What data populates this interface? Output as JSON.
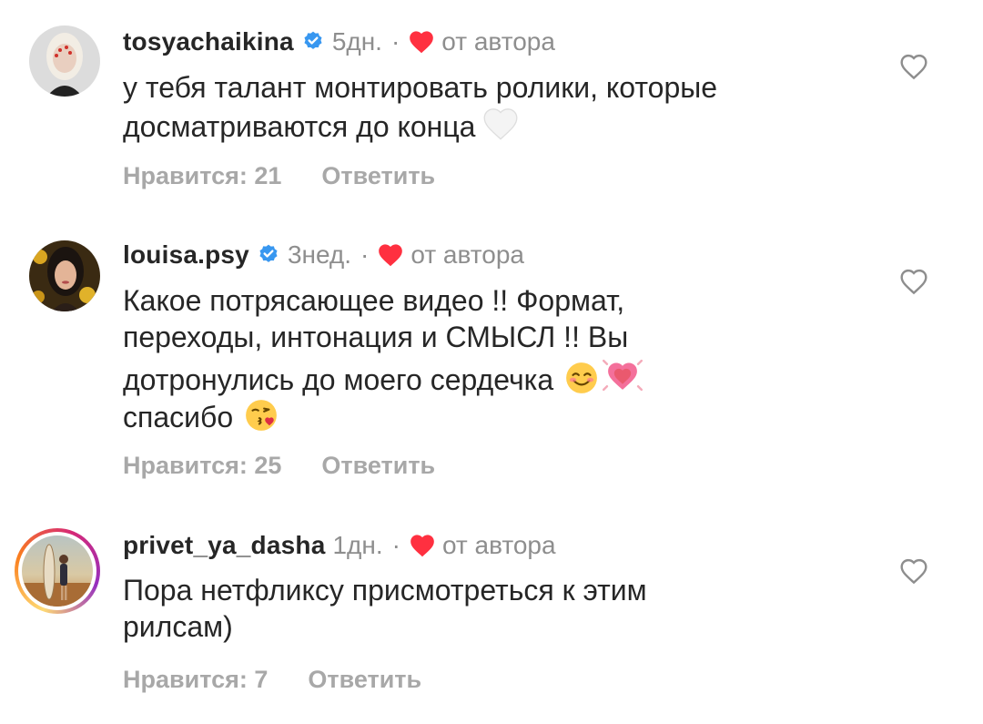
{
  "colors": {
    "text": "#262626",
    "muted": "#8e8e8e",
    "action": "#a8a8a8",
    "heart_red": "#ff3040",
    "verified_blue": "#3897f0"
  },
  "comments": [
    {
      "username": "tosyachaikina",
      "verified": true,
      "time": "5дн.",
      "author_liked": true,
      "author_label": "от автора",
      "text_lines": [
        "у тебя талант монтировать ролики, которые",
        "досматриваются до конца"
      ],
      "emoji": [
        "white-heart"
      ],
      "likes_label": "Нравится: 21",
      "reply_label": "Ответить"
    },
    {
      "username": "louisa.psy",
      "verified": true,
      "time": "3нед.",
      "author_liked": true,
      "author_label": "от автора",
      "text_lines": [
        "Какое потрясающее видео !! Формат,",
        "переходы, интонация и СМЫСЛ !! Вы",
        "дотронулись до моего сердечка",
        "спасибо"
      ],
      "emoji": [
        "smiling-face",
        "growing-heart",
        "face-blowing-kiss"
      ],
      "likes_label": "Нравится: 25",
      "reply_label": "Ответить"
    },
    {
      "username": "privet_ya_dasha",
      "verified": false,
      "time": "1дн.",
      "author_liked": true,
      "author_label": "от автора",
      "text_lines": [
        "Пора нетфликсу присмотреться к этим",
        "рилсам)"
      ],
      "emoji": [],
      "likes_label": "Нравится: 7",
      "reply_label": "Ответить"
    }
  ],
  "icons": {
    "like": "heart-outline-icon",
    "verified": "verified-badge-icon",
    "author_heart": "red-heart-icon",
    "separator": "·"
  }
}
